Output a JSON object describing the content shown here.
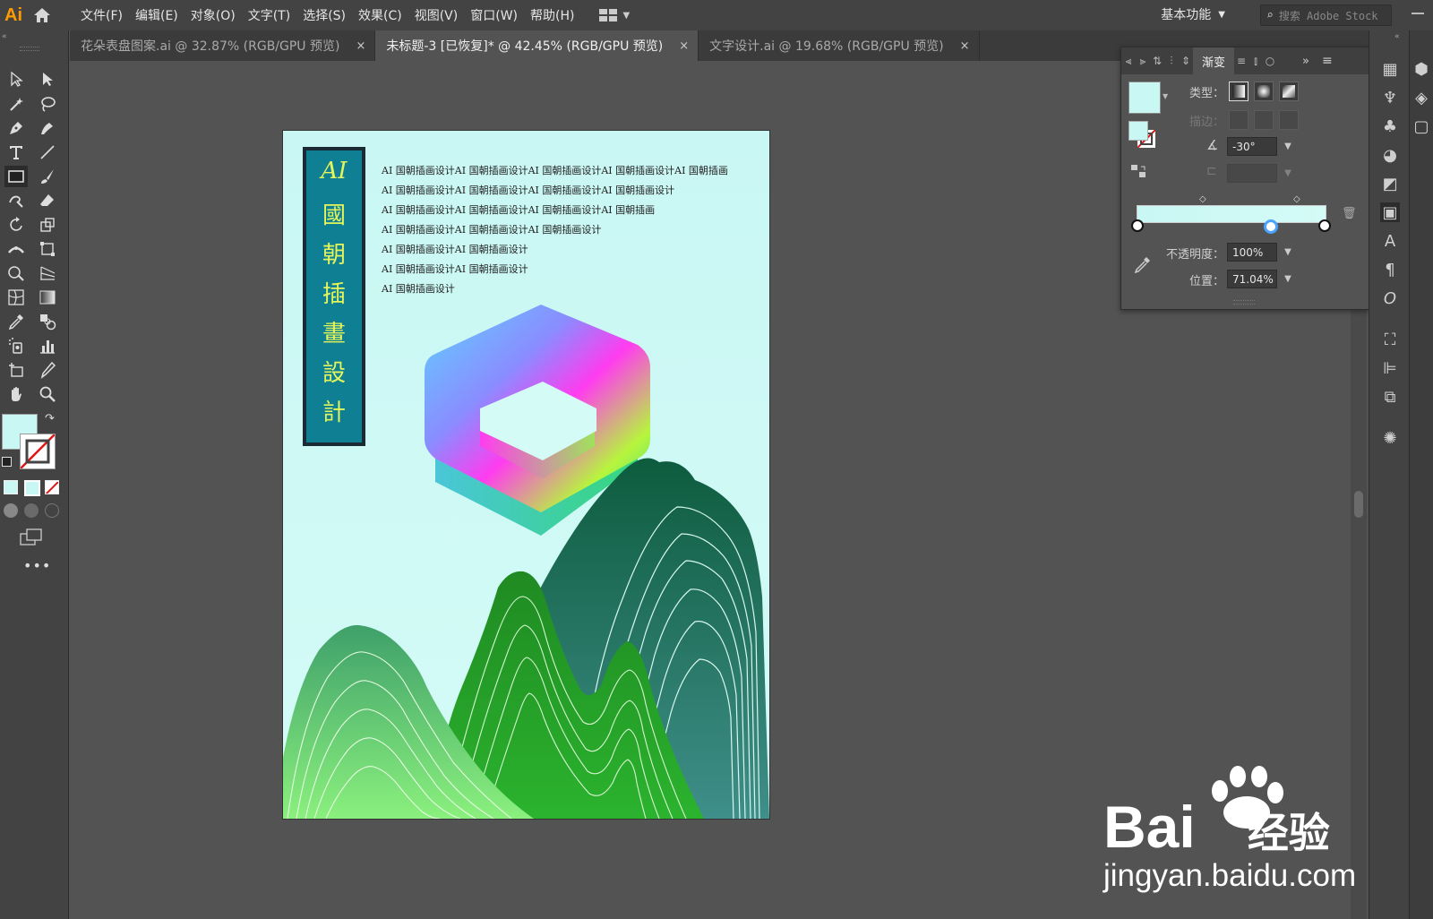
{
  "app": {
    "logo": "Ai"
  },
  "menu": [
    "文件(F)",
    "编辑(E)",
    "对象(O)",
    "文字(T)",
    "选择(S)",
    "效果(C)",
    "视图(V)",
    "窗口(W)",
    "帮助(H)"
  ],
  "workspace_label": "基本功能",
  "stock_placeholder": "搜索 Adobe Stock",
  "tabs": [
    {
      "label": "花朵表盘图案.ai @ 32.87% (RGB/GPU 预览)",
      "close": "×"
    },
    {
      "label": "未标题-3 [已恢复]* @ 42.45% (RGB/GPU 预览)",
      "close": "×"
    },
    {
      "label": "文字设计.ai @ 19.68% (RGB/GPU 预览)",
      "close": "×"
    }
  ],
  "artboard": {
    "title_chars": [
      "AI",
      "國",
      "朝",
      "插",
      "畫",
      "設",
      "計"
    ],
    "text_lines": [
      "AI 国朝插画设计AI 国朝插画设计AI 国朝插画设计AI 国朝插画设计AI 国朝插画",
      "AI 国朝插画设计AI 国朝插画设计AI 国朝插画设计AI 国朝插画设计",
      "AI 国朝插画设计AI 国朝插画设计AI 国朝插画设计AI 国朝插画",
      "AI 国朝插画设计AI 国朝插画设计AI 国朝插画设计",
      "AI 国朝插画设计AI 国朝插画设计",
      "AI 国朝插画设计AI 国朝插画设计",
      "AI 国朝插画设计"
    ]
  },
  "gradient_panel": {
    "tab_label": "渐变",
    "type_label": "类型：",
    "stroke_label": "描边：",
    "angle_value": "-30°",
    "opacity_label": "不透明度：",
    "opacity_value": "100%",
    "position_label": "位置：",
    "position_value": "71.04%"
  },
  "colors": {
    "fill": "#c9f7f4",
    "accent": "#ff9a00",
    "title_box": "#0f7f93"
  },
  "watermark": {
    "brand": "Bai",
    "brand_cn": "经验",
    "url": "jingyan.baidu.com"
  }
}
